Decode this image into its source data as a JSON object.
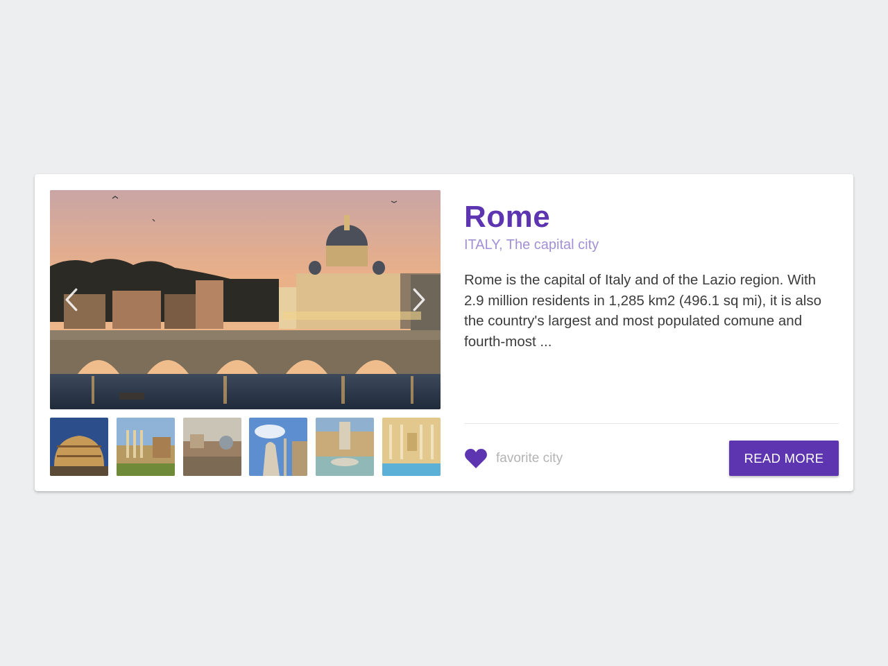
{
  "card": {
    "title": "Rome",
    "subtitle": "ITALY, The capital city",
    "description": "Rome is the capital of Italy and of the Lazio region. With 2.9 million residents in 1,285 km2 (496.1 sq mi), it is also the country's largest and most populated comune and fourth-most ...",
    "favorite_label": "favorite city",
    "read_more_label": "READ MORE"
  },
  "gallery": {
    "prev_icon": "chevron-left-icon",
    "next_icon": "chevron-right-icon",
    "thumbnail_count": 6
  },
  "colors": {
    "accent": "#5e35b1",
    "subtitle": "#a38fd5",
    "muted": "#b3b3b3",
    "background": "#edeef0"
  },
  "icons": {
    "favorite": "heart-icon"
  }
}
